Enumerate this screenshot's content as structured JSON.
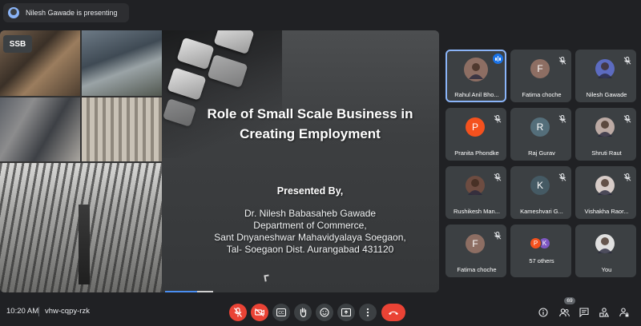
{
  "presenting": {
    "text": "Nilesh Gawade is presenting"
  },
  "slide": {
    "badge": "SSB",
    "title_line1": "Role of Small Scale Business in",
    "title_line2": "Creating Employment",
    "presented_by": "Presented By,",
    "details": [
      "Dr. Nilesh Babasaheb Gawade",
      "Department of Commerce,",
      "Sant Dnyaneshwar Mahavidyalaya Soegaon,",
      "Tal- Soegaon Dist. Aurangabad 431120"
    ]
  },
  "participants": [
    {
      "name": "Rahul Anil Bho...",
      "initial": "",
      "avatar_color": "#8d6e63",
      "photo": true,
      "speaking": true
    },
    {
      "name": "Fatima choche",
      "initial": "F",
      "avatar_color": "#8d6e63"
    },
    {
      "name": "Nilesh Gawade",
      "initial": "",
      "avatar_color": "#5c6bc0",
      "photo": true
    },
    {
      "name": "Pranita Phondke",
      "initial": "P",
      "avatar_color": "#f4511e"
    },
    {
      "name": "Raj Gurav",
      "initial": "R",
      "avatar_color": "#546e7a"
    },
    {
      "name": "Shruti Raut",
      "initial": "",
      "avatar_color": "#bcaaa4",
      "photo": true
    },
    {
      "name": "Rushikesh Man...",
      "initial": "",
      "avatar_color": "#6d4c41",
      "photo": true
    },
    {
      "name": "Kameshvari G...",
      "initial": "K",
      "avatar_color": "#455a64"
    },
    {
      "name": "Vishakha Raor...",
      "initial": "",
      "avatar_color": "#d7ccc8",
      "photo": true
    },
    {
      "name": "Fatima choche",
      "initial": "F",
      "avatar_color": "#8d6e63"
    },
    {
      "name": "57 others",
      "initial": "",
      "others": true
    },
    {
      "name": "You",
      "initial": "",
      "avatar_color": "#e0e0e0",
      "photo": true
    }
  ],
  "others_avatars": [
    {
      "initial": "P",
      "color": "#f4511e"
    },
    {
      "initial": "K",
      "color": "#7e57c2"
    }
  ],
  "bottom": {
    "time": "10:20 AM",
    "meeting_code": "vhw-cqpy-rzk",
    "participant_count": "69"
  },
  "controls": [
    {
      "name": "mic-toggle",
      "icon": "mic-off-icon",
      "color": "#ea4335"
    },
    {
      "name": "camera-toggle",
      "icon": "camera-off-icon",
      "color": "#ea4335"
    },
    {
      "name": "captions",
      "icon": "cc-icon",
      "color": "#3c4043"
    },
    {
      "name": "raise-hand",
      "icon": "hand-icon",
      "color": "#3c4043"
    },
    {
      "name": "reactions",
      "icon": "emoji-icon",
      "color": "#3c4043"
    },
    {
      "name": "present",
      "icon": "present-icon",
      "color": "#3c4043"
    },
    {
      "name": "more-options",
      "icon": "more-vert-icon",
      "color": "#3c4043"
    },
    {
      "name": "leave-call",
      "icon": "hangup-icon",
      "color": "#ea4335"
    }
  ]
}
